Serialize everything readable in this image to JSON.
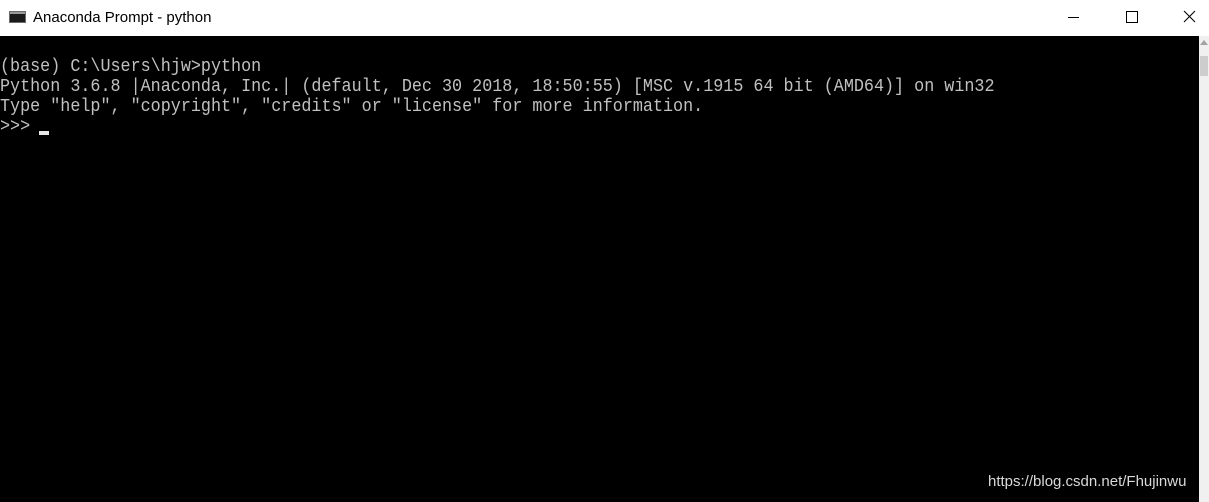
{
  "window": {
    "title": "Anaconda Prompt - python",
    "icon": "console-icon"
  },
  "controls": {
    "minimize_icon": "minimize-icon",
    "maximize_icon": "maximize-icon",
    "close_icon": "close-icon"
  },
  "console": {
    "lines": [
      "(base) C:\\Users\\hjw>python",
      "Python 3.6.8 |Anaconda, Inc.| (default, Dec 30 2018, 18:50:55) [MSC v.1915 64 bit (AMD64)] on win32",
      "Type \"help\", \"copyright\", \"credits\" or \"license\" for more information.",
      ">>> "
    ],
    "text_color": "#c0c0c0",
    "background_color": "#000000"
  },
  "watermark": "https://blog.csdn.net/Fhujinwu"
}
